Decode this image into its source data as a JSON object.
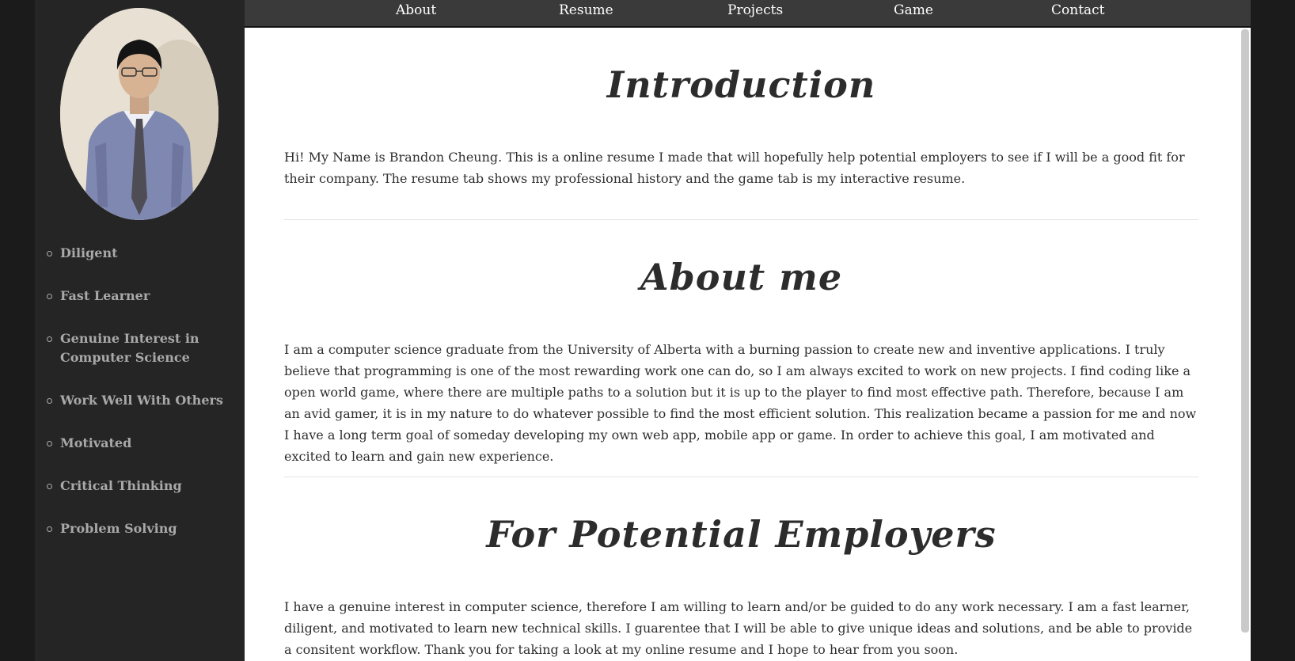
{
  "nav": {
    "items": [
      "About",
      "Resume",
      "Projects",
      "Game",
      "Contact"
    ]
  },
  "sidebar": {
    "traits": [
      "Diligent",
      "Fast Learner",
      "Genuine Interest in Computer Science",
      "Work Well With Others",
      "Motivated",
      "Critical Thinking",
      "Problem Solving"
    ]
  },
  "sections": [
    {
      "title": "Introduction",
      "body": "Hi! My Name is Brandon Cheung. This is a online resume I made that will hopefully help potential employers to see if I will be a good fit for their company. The resume tab shows my professional history and the game tab is my interactive resume."
    },
    {
      "title": "About me",
      "body": "I am a computer science graduate from the University of Alberta with a burning passion to create new and inventive applications. I truly believe that programming is one of the most rewarding work one can do, so I am always excited to work on new projects. I find coding like a open world game, where there are multiple paths to a solution but it is up to the player to find most effective path. Therefore, because I am an avid gamer, it is in my nature to do whatever possible to find the most efficient solution. This realization became a passion for me and now I have a long term goal of someday developing my own web app, mobile app or game. In order to achieve this goal, I am motivated and excited to learn and gain new experience."
    },
    {
      "title": "For Potential Employers",
      "body": "I have a genuine interest in computer science, therefore I am willing to learn and/or be guided to do any work necessary. I am a fast learner, diligent, and motivated to learn new technical skills. I guarentee that I will be able to give unique ideas and solutions, and be able to provide a consitent workflow. Thank you for taking a look at my online resume and I hope to hear from you soon."
    }
  ],
  "colors": {
    "background": "#1b1b1b",
    "sidebar": "#252525",
    "nav": "#3a3a3a",
    "content": "#ffffff",
    "heading": "#2c2c2c",
    "trait_text": "#a9a9a9"
  }
}
